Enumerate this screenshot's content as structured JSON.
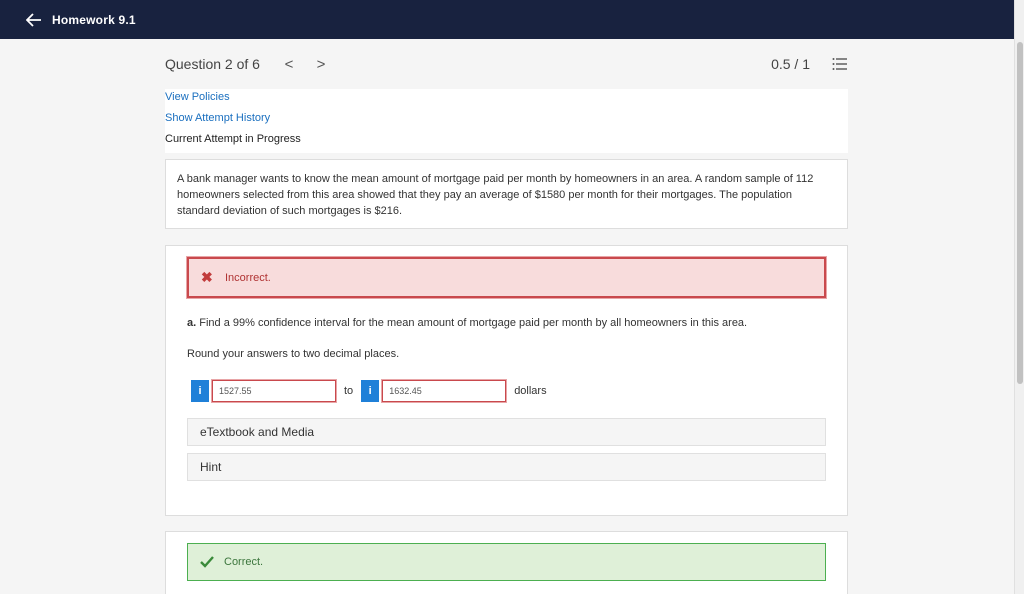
{
  "header": {
    "title": "Homework 9.1"
  },
  "question_nav": {
    "label": "Question 2 of 6",
    "prev_glyph": "<",
    "next_glyph": ">",
    "score": "0.5 / 1"
  },
  "links": {
    "view_policies": "View Policies",
    "show_history": "Show Attempt History",
    "current_attempt": "Current Attempt in Progress"
  },
  "problem": {
    "text": "A bank manager wants to know the mean amount of mortgage paid per month by homeowners in an area. A random sample of 112 homeowners selected from this area showed that they pay an average of $1580 per month for their mortgages. The population standard deviation of such mortgages is $216."
  },
  "part_a": {
    "status": "Incorrect.",
    "prefix": "a.",
    "question": " Find a 99% confidence interval for the mean amount of mortgage paid per month by all homeowners in this area.",
    "round_instruction": "Round your answers to two decimal places.",
    "info_glyph": "i",
    "lower_value": "1527.55",
    "to_label": "to",
    "upper_value": "1632.45",
    "unit": "dollars",
    "etextbook_label": "eTextbook and Media",
    "hint_label": "Hint"
  },
  "part_b": {
    "status": "Correct."
  },
  "colors": {
    "topbar": "#18223f",
    "link": "#1a6fbf",
    "info_button": "#1f80d8",
    "incorrect_border": "#c9494d",
    "correct_border": "#4caf50"
  }
}
